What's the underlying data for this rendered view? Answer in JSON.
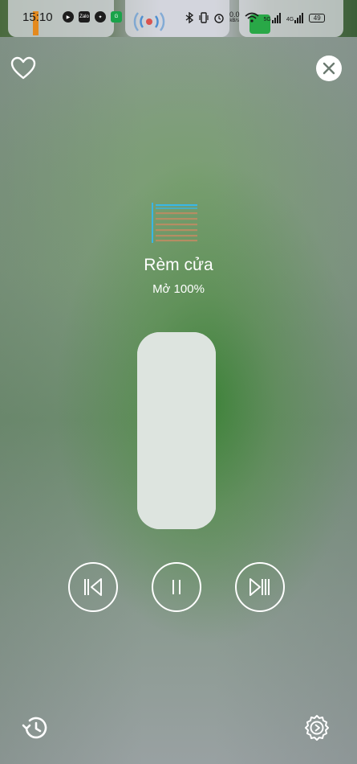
{
  "status_bar": {
    "time": "15:10",
    "speed_value": "0.0",
    "speed_unit": "kB/s",
    "network_1": "5G",
    "network_2": "4G",
    "battery": "49",
    "app_icons": [
      "play-circle-icon",
      "zalo-icon",
      "messenger-icon",
      "green-app-icon"
    ]
  },
  "header": {
    "favorite_icon": "heart-icon",
    "close_icon": "close-icon"
  },
  "device": {
    "icon": "curtain-icon",
    "name": "Rèm cửa",
    "status": "Mở 100%",
    "open_level_percent": 100
  },
  "controls": {
    "prev_icon": "skip-previous-icon",
    "pause_icon": "pause-icon",
    "next_icon": "skip-next-icon"
  },
  "footer": {
    "history_icon": "history-icon",
    "settings_icon": "settings-gear-icon"
  },
  "colors": {
    "accent": "#ffffff",
    "curtain_blue": "#39b6e6",
    "curtain_brown": "#b58d63"
  }
}
